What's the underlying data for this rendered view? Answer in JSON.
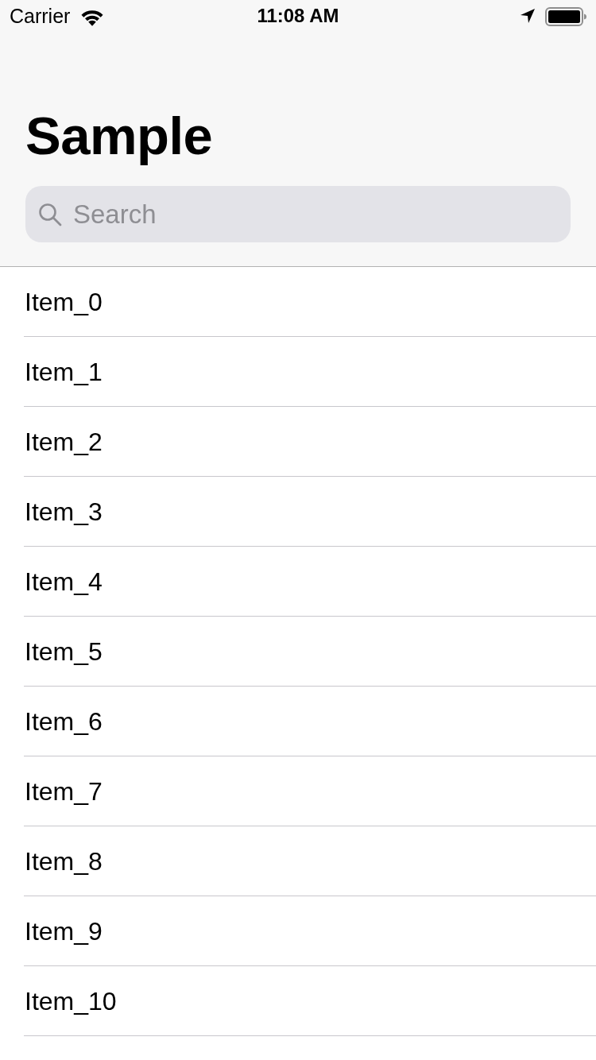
{
  "status_bar": {
    "carrier": "Carrier",
    "time": "11:08 AM"
  },
  "navigation": {
    "title": "Sample",
    "search": {
      "placeholder": "Search"
    }
  },
  "list": {
    "items": [
      {
        "label": "Item_0"
      },
      {
        "label": "Item_1"
      },
      {
        "label": "Item_2"
      },
      {
        "label": "Item_3"
      },
      {
        "label": "Item_4"
      },
      {
        "label": "Item_5"
      },
      {
        "label": "Item_6"
      },
      {
        "label": "Item_7"
      },
      {
        "label": "Item_8"
      },
      {
        "label": "Item_9"
      },
      {
        "label": "Item_10"
      }
    ]
  }
}
